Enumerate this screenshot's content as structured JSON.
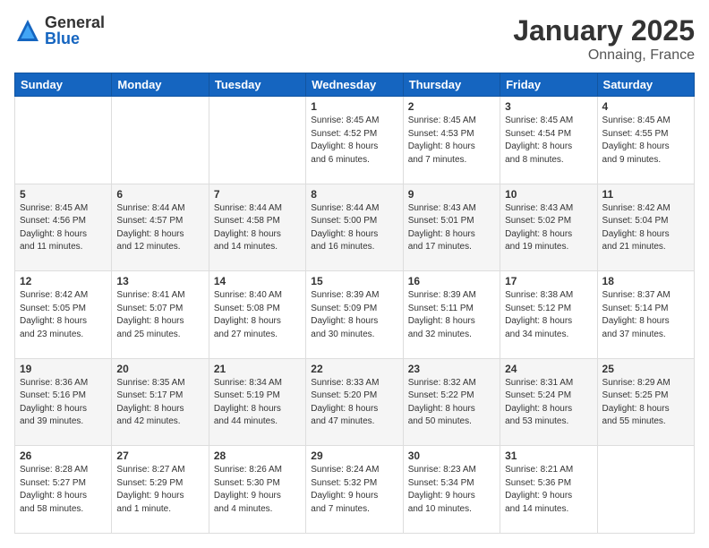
{
  "logo": {
    "general": "General",
    "blue": "Blue"
  },
  "header": {
    "month": "January 2025",
    "location": "Onnaing, France"
  },
  "weekdays": [
    "Sunday",
    "Monday",
    "Tuesday",
    "Wednesday",
    "Thursday",
    "Friday",
    "Saturday"
  ],
  "weeks": [
    [
      {
        "day": "",
        "info": ""
      },
      {
        "day": "",
        "info": ""
      },
      {
        "day": "",
        "info": ""
      },
      {
        "day": "1",
        "info": "Sunrise: 8:45 AM\nSunset: 4:52 PM\nDaylight: 8 hours\nand 6 minutes."
      },
      {
        "day": "2",
        "info": "Sunrise: 8:45 AM\nSunset: 4:53 PM\nDaylight: 8 hours\nand 7 minutes."
      },
      {
        "day": "3",
        "info": "Sunrise: 8:45 AM\nSunset: 4:54 PM\nDaylight: 8 hours\nand 8 minutes."
      },
      {
        "day": "4",
        "info": "Sunrise: 8:45 AM\nSunset: 4:55 PM\nDaylight: 8 hours\nand 9 minutes."
      }
    ],
    [
      {
        "day": "5",
        "info": "Sunrise: 8:45 AM\nSunset: 4:56 PM\nDaylight: 8 hours\nand 11 minutes."
      },
      {
        "day": "6",
        "info": "Sunrise: 8:44 AM\nSunset: 4:57 PM\nDaylight: 8 hours\nand 12 minutes."
      },
      {
        "day": "7",
        "info": "Sunrise: 8:44 AM\nSunset: 4:58 PM\nDaylight: 8 hours\nand 14 minutes."
      },
      {
        "day": "8",
        "info": "Sunrise: 8:44 AM\nSunset: 5:00 PM\nDaylight: 8 hours\nand 16 minutes."
      },
      {
        "day": "9",
        "info": "Sunrise: 8:43 AM\nSunset: 5:01 PM\nDaylight: 8 hours\nand 17 minutes."
      },
      {
        "day": "10",
        "info": "Sunrise: 8:43 AM\nSunset: 5:02 PM\nDaylight: 8 hours\nand 19 minutes."
      },
      {
        "day": "11",
        "info": "Sunrise: 8:42 AM\nSunset: 5:04 PM\nDaylight: 8 hours\nand 21 minutes."
      }
    ],
    [
      {
        "day": "12",
        "info": "Sunrise: 8:42 AM\nSunset: 5:05 PM\nDaylight: 8 hours\nand 23 minutes."
      },
      {
        "day": "13",
        "info": "Sunrise: 8:41 AM\nSunset: 5:07 PM\nDaylight: 8 hours\nand 25 minutes."
      },
      {
        "day": "14",
        "info": "Sunrise: 8:40 AM\nSunset: 5:08 PM\nDaylight: 8 hours\nand 27 minutes."
      },
      {
        "day": "15",
        "info": "Sunrise: 8:39 AM\nSunset: 5:09 PM\nDaylight: 8 hours\nand 30 minutes."
      },
      {
        "day": "16",
        "info": "Sunrise: 8:39 AM\nSunset: 5:11 PM\nDaylight: 8 hours\nand 32 minutes."
      },
      {
        "day": "17",
        "info": "Sunrise: 8:38 AM\nSunset: 5:12 PM\nDaylight: 8 hours\nand 34 minutes."
      },
      {
        "day": "18",
        "info": "Sunrise: 8:37 AM\nSunset: 5:14 PM\nDaylight: 8 hours\nand 37 minutes."
      }
    ],
    [
      {
        "day": "19",
        "info": "Sunrise: 8:36 AM\nSunset: 5:16 PM\nDaylight: 8 hours\nand 39 minutes."
      },
      {
        "day": "20",
        "info": "Sunrise: 8:35 AM\nSunset: 5:17 PM\nDaylight: 8 hours\nand 42 minutes."
      },
      {
        "day": "21",
        "info": "Sunrise: 8:34 AM\nSunset: 5:19 PM\nDaylight: 8 hours\nand 44 minutes."
      },
      {
        "day": "22",
        "info": "Sunrise: 8:33 AM\nSunset: 5:20 PM\nDaylight: 8 hours\nand 47 minutes."
      },
      {
        "day": "23",
        "info": "Sunrise: 8:32 AM\nSunset: 5:22 PM\nDaylight: 8 hours\nand 50 minutes."
      },
      {
        "day": "24",
        "info": "Sunrise: 8:31 AM\nSunset: 5:24 PM\nDaylight: 8 hours\nand 53 minutes."
      },
      {
        "day": "25",
        "info": "Sunrise: 8:29 AM\nSunset: 5:25 PM\nDaylight: 8 hours\nand 55 minutes."
      }
    ],
    [
      {
        "day": "26",
        "info": "Sunrise: 8:28 AM\nSunset: 5:27 PM\nDaylight: 8 hours\nand 58 minutes."
      },
      {
        "day": "27",
        "info": "Sunrise: 8:27 AM\nSunset: 5:29 PM\nDaylight: 9 hours\nand 1 minute."
      },
      {
        "day": "28",
        "info": "Sunrise: 8:26 AM\nSunset: 5:30 PM\nDaylight: 9 hours\nand 4 minutes."
      },
      {
        "day": "29",
        "info": "Sunrise: 8:24 AM\nSunset: 5:32 PM\nDaylight: 9 hours\nand 7 minutes."
      },
      {
        "day": "30",
        "info": "Sunrise: 8:23 AM\nSunset: 5:34 PM\nDaylight: 9 hours\nand 10 minutes."
      },
      {
        "day": "31",
        "info": "Sunrise: 8:21 AM\nSunset: 5:36 PM\nDaylight: 9 hours\nand 14 minutes."
      },
      {
        "day": "",
        "info": ""
      }
    ]
  ]
}
